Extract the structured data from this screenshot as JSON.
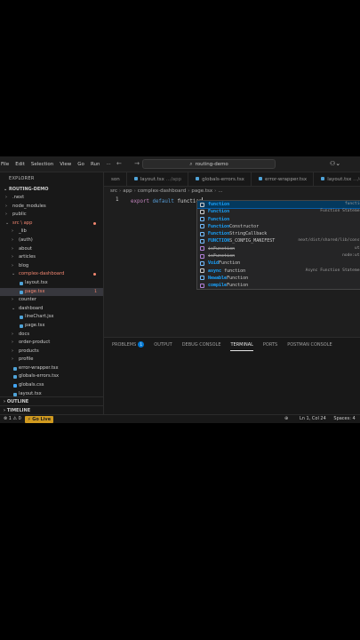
{
  "menu": [
    "File",
    "Edit",
    "Selection",
    "View",
    "Go",
    "Run",
    "···"
  ],
  "nav_arrows": "← →",
  "search": {
    "icon": "search-icon",
    "text": "routing-demo"
  },
  "titlebar_right": "⚇⌄",
  "explorer": {
    "header": "EXPLORER",
    "root": "ROUTING-DEMO",
    "items": [
      {
        "label": ".next",
        "depth": 0,
        "type": "folder",
        "open": false
      },
      {
        "label": "node_modules",
        "depth": 0,
        "type": "folder",
        "open": false
      },
      {
        "label": "public",
        "depth": 0,
        "type": "folder",
        "open": false
      },
      {
        "label": "src \\ app",
        "depth": 0,
        "type": "folder",
        "open": true,
        "error": true
      },
      {
        "label": "_lib",
        "depth": 1,
        "type": "folder",
        "open": false
      },
      {
        "label": "(auth)",
        "depth": 1,
        "type": "folder",
        "open": false
      },
      {
        "label": "about",
        "depth": 1,
        "type": "folder",
        "open": false
      },
      {
        "label": "articles",
        "depth": 1,
        "type": "folder",
        "open": false
      },
      {
        "label": "blog",
        "depth": 1,
        "type": "folder",
        "open": false
      },
      {
        "label": "complex-dashboard",
        "depth": 1,
        "type": "folder",
        "open": true,
        "error": true
      },
      {
        "label": "layout.tsx",
        "depth": 2,
        "type": "file"
      },
      {
        "label": "page.tsx",
        "depth": 2,
        "type": "file",
        "error": true,
        "active": true,
        "badge": "1"
      },
      {
        "label": "counter",
        "depth": 1,
        "type": "folder",
        "open": false
      },
      {
        "label": "dashboard",
        "depth": 1,
        "type": "folder",
        "open": true
      },
      {
        "label": "lineChart.jsx",
        "depth": 2,
        "type": "file"
      },
      {
        "label": "page.tsx",
        "depth": 2,
        "type": "file"
      },
      {
        "label": "docs",
        "depth": 1,
        "type": "folder",
        "open": false
      },
      {
        "label": "order-product",
        "depth": 1,
        "type": "folder",
        "open": false
      },
      {
        "label": "products",
        "depth": 1,
        "type": "folder",
        "open": false
      },
      {
        "label": "profile",
        "depth": 1,
        "type": "folder",
        "open": false
      },
      {
        "label": "error-wrapper.tsx",
        "depth": 1,
        "type": "file"
      },
      {
        "label": "globals-errors.tsx",
        "depth": 1,
        "type": "file"
      },
      {
        "label": "globals.css",
        "depth": 1,
        "type": "file"
      },
      {
        "label": "layout.tsx",
        "depth": 1,
        "type": "file"
      }
    ],
    "outline": "OUTLINE",
    "timeline": "TIMELINE"
  },
  "tabs": [
    {
      "label": "son",
      "hint": ""
    },
    {
      "label": "layout.tsx",
      "hint": " .../app"
    },
    {
      "label": "globals-errors.tsx",
      "hint": ""
    },
    {
      "label": "error-wrapper.tsx",
      "hint": ""
    },
    {
      "label": "layout.tsx",
      "hint": " .../comple"
    }
  ],
  "breadcrumb": [
    "src",
    "app",
    "complex-dashboard",
    "page.tsx",
    "..."
  ],
  "editor": {
    "line_no": "1",
    "kw1": "export",
    "kw2": "default",
    "typed": "function"
  },
  "suggestions": [
    {
      "prefix": "function",
      "rest": "",
      "detail": "function",
      "kind": "snip"
    },
    {
      "prefix": "Function",
      "rest": "",
      "detail": "Function Statement",
      "kind": "snip"
    },
    {
      "prefix": "Function",
      "rest": "",
      "detail": "",
      "kind": "var"
    },
    {
      "prefix": "Function",
      "rest": "Constructor",
      "detail": "",
      "kind": "var"
    },
    {
      "prefix": "Function",
      "rest": "StringCallback",
      "detail": "",
      "kind": "var"
    },
    {
      "prefix": "FUNCTION",
      "rest": "S_CONFIG_MANIFEST",
      "detail": "next/dist/shared/lib/consta",
      "kind": "var"
    },
    {
      "prefix": "",
      "rest": "isFunction",
      "detail": "util",
      "kind": "fn",
      "strike": true
    },
    {
      "prefix": "",
      "rest": "isFunction",
      "detail": "node:util",
      "kind": "fn",
      "strike": true
    },
    {
      "prefix": "Void",
      "rest": "Function",
      "detail": "",
      "kind": "var"
    },
    {
      "prefix": "async ",
      "rest": "function",
      "detail": "Async Function Statement",
      "kind": "snip"
    },
    {
      "prefix": "Newable",
      "rest": "Function",
      "detail": "",
      "kind": "var"
    },
    {
      "prefix": "compile",
      "rest": "Function",
      "detail": "v",
      "kind": "fn"
    }
  ],
  "panel_tabs": [
    "PROBLEMS",
    "OUTPUT",
    "DEBUG CONSOLE",
    "TERMINAL",
    "PORTS",
    "POSTMAN CONSOLE"
  ],
  "problems_count": "1",
  "status": {
    "errors": "⊗ 1 ⚠ 0",
    "live": "⚡ Go Live",
    "position": "Ln 1, Col 24",
    "spaces": "Spaces: 4",
    "encoding": "UT"
  }
}
